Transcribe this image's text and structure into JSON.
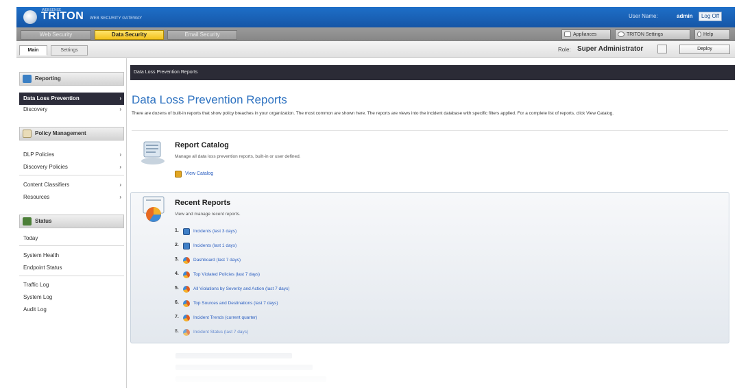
{
  "header": {
    "logo_small": "WEBSENSE",
    "logo": "TRITON",
    "logo_sub": "WEB SECURITY GATEWAY",
    "user_label": "User Name:",
    "user_name": "admin",
    "logoff": "Log Off"
  },
  "modules": {
    "tabs": [
      "Web Security",
      "Data Security",
      "Email Security"
    ],
    "active": "Data Security",
    "tools": [
      "Appliances",
      "TRITON Settings",
      "Help"
    ]
  },
  "subbar": {
    "tabs": [
      "Main",
      "Settings"
    ],
    "role_label": "Role:",
    "role_value": "Super Administrator",
    "deploy": "Deploy"
  },
  "sidebar": {
    "sections": [
      {
        "title": "Reporting",
        "icon": "reporting-icon",
        "icon_color": "#3a7fc4"
      },
      {
        "title": "Policy Management",
        "icon": "policy-icon",
        "icon_color": "#d8c08a"
      },
      {
        "title": "Status",
        "icon": "status-icon",
        "icon_color": "#4c7f38"
      }
    ],
    "reporting_items": [
      "Data Loss Prevention",
      "Discovery"
    ],
    "policy_items": [
      "DLP Policies",
      "Discovery Policies",
      "Content Classifiers",
      "Resources"
    ],
    "status_items": [
      "Today",
      "System Health",
      "Endpoint Status",
      "Traffic Log",
      "System Log",
      "Audit Log"
    ]
  },
  "main": {
    "breadcrumb": "Data Loss Prevention Reports",
    "title": "Data Loss Prevention Reports",
    "description": "There are dozens of built-in reports that show policy breaches in your organization. The most common are shown here. The reports are views into the incident database with specific filters applied. For a complete list of reports, click View Catalog.",
    "catalog": {
      "title": "Report Catalog",
      "desc": "Manage all data loss prevention reports, built-in or user defined.",
      "link": "View Catalog"
    },
    "recent": {
      "title": "Recent Reports",
      "desc": "View and manage recent reports.",
      "items": [
        {
          "num": "1.",
          "icon": "grid",
          "label": "Incidents (last 3 days)"
        },
        {
          "num": "2.",
          "icon": "grid",
          "label": "Incidents (last 1 days)"
        },
        {
          "num": "3.",
          "icon": "pie",
          "label": "Dashboard (last 7 days)"
        },
        {
          "num": "4.",
          "icon": "pie",
          "label": "Top Violated Policies (last 7 days)"
        },
        {
          "num": "5.",
          "icon": "pie",
          "label": "All Violations by Severity and Action (last 7 days)"
        },
        {
          "num": "6.",
          "icon": "pie",
          "label": "Top Sources and Destinations (last 7 days)"
        },
        {
          "num": "7.",
          "icon": "pie",
          "label": "Incident Trends (current quarter)"
        },
        {
          "num": "8.",
          "icon": "pie",
          "label": "Incident Status (last 7 days)"
        }
      ]
    }
  }
}
